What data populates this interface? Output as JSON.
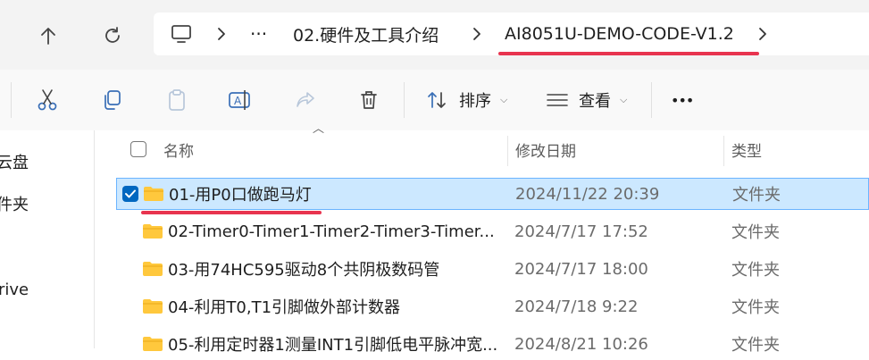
{
  "nav": {
    "back_icon": "arrow-up-icon",
    "refresh_icon": "refresh-icon",
    "breadcrumb": {
      "pc_icon": "computer-icon",
      "overflow": "···",
      "items": [
        "02.硬件及工具介绍",
        "AI8051U-DEMO-CODE-V1.2"
      ]
    }
  },
  "toolbar": {
    "sort_label": "排序",
    "view_label": "查看",
    "more_label": "•••"
  },
  "sidebar": {
    "items": [
      "云盘",
      "件夹",
      "rive"
    ]
  },
  "columns": {
    "name": "名称",
    "date": "修改日期",
    "type": "类型"
  },
  "files": [
    {
      "name": "01-用P0口做跑马灯",
      "date": "2024/11/22 20:39",
      "type": "文件夹",
      "selected": true
    },
    {
      "name": "02-Timer0-Timer1-Timer2-Timer3-Timer...",
      "date": "2024/7/17 17:52",
      "type": "文件夹",
      "selected": false
    },
    {
      "name": "03-用74HC595驱动8个共阴极数码管",
      "date": "2024/7/17 18:00",
      "type": "文件夹",
      "selected": false
    },
    {
      "name": "04-利用T0,T1引脚做外部计数器",
      "date": "2024/7/18 9:22",
      "type": "文件夹",
      "selected": false
    },
    {
      "name": "05-利用定时器1测量INT1引脚低电平脉冲宽...",
      "date": "2024/8/21 10:26",
      "type": "文件夹",
      "selected": false
    }
  ],
  "colors": {
    "accent": "#0067c0",
    "selection": "#cce8ff",
    "annotation_red": "#e8344f",
    "folder": "#ffc83d"
  }
}
